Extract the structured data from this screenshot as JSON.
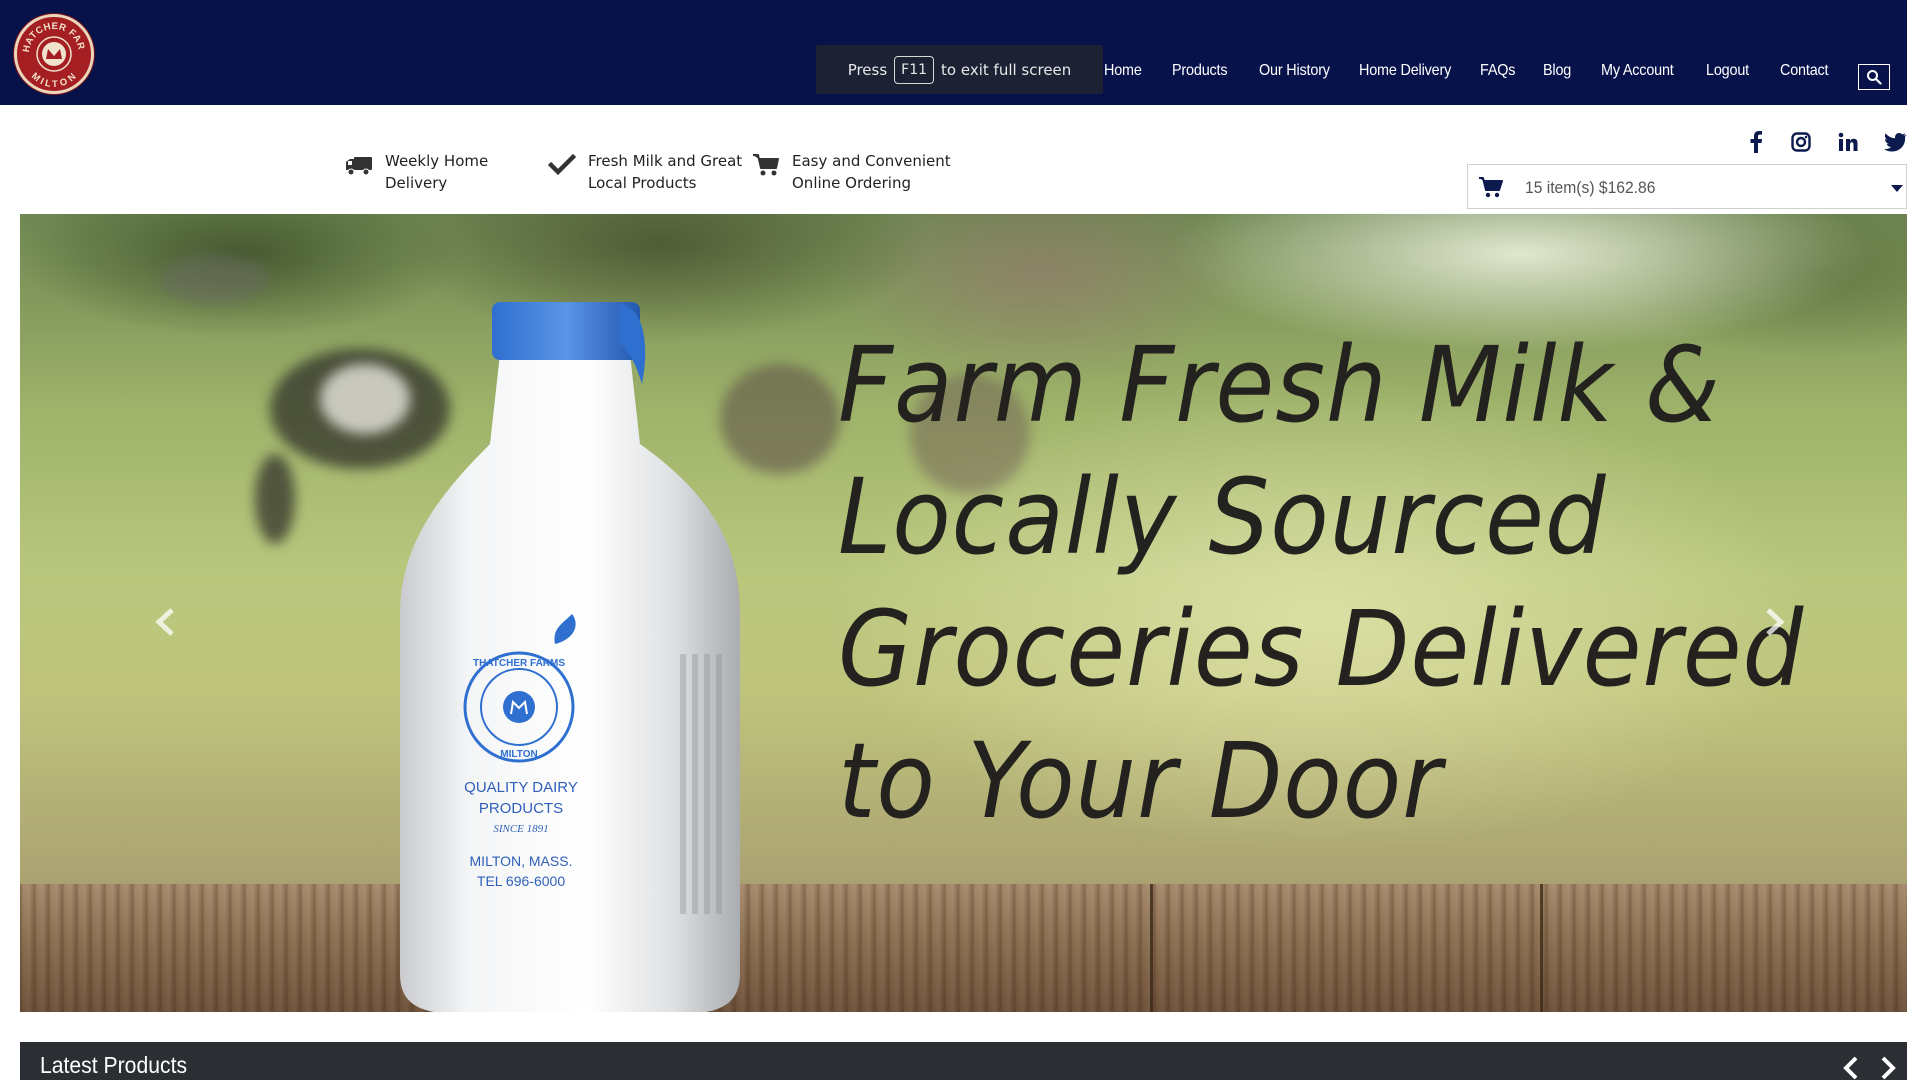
{
  "logo": {
    "alt": "Thatcher Farm Milton logo",
    "top_text": "THATCHER FARM",
    "bottom_text": "MILTON"
  },
  "nav": {
    "items": [
      "Home",
      "Products",
      "Our History",
      "Home Delivery",
      "FAQs",
      "Blog",
      "My Account",
      "Logout",
      "Contact"
    ]
  },
  "fullscreen_toast": {
    "prefix": "Press",
    "key": "F11",
    "suffix": "to exit full screen"
  },
  "features": [
    {
      "icon": "truck-icon",
      "line1": "Weekly Home",
      "line2": "Delivery"
    },
    {
      "icon": "check-icon",
      "line1": "Fresh Milk and Great",
      "line2": "Local Products"
    },
    {
      "icon": "cart-icon",
      "line1": "Easy and Convenient",
      "line2": "Online Ordering"
    }
  ],
  "social": [
    "facebook-icon",
    "instagram-icon",
    "linkedin-icon",
    "twitter-icon"
  ],
  "cart": {
    "summary": "15 item(s) $162.86"
  },
  "hero": {
    "headline": [
      "Farm Fresh Milk &",
      "Locally Sourced",
      "Groceries Delivered",
      "to Your Door"
    ],
    "bottle_label": {
      "brand_top": "THATCHER FARMS",
      "brand_bottom": "MILTON",
      "line1": "QUALITY DAIRY",
      "line2": "PRODUCTS",
      "since": "SINCE 1891",
      "city": "MILTON, MASS.",
      "tel": "TEL 696-6000"
    }
  },
  "latest": {
    "title": "Latest Products"
  },
  "colors": {
    "header_bg": "#07124a",
    "logo_red": "#a41e22",
    "bottle_blue": "#2f6fd0",
    "dark_bar": "#2b2f33"
  }
}
